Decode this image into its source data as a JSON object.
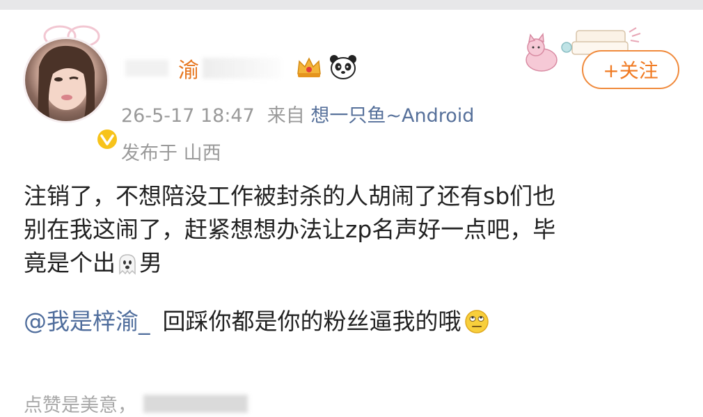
{
  "post": {
    "user": {
      "name_visible": "渝",
      "verified": true,
      "badges": [
        "crown-icon",
        "panda-icon"
      ]
    },
    "meta": {
      "date": "26-5-17 18:47",
      "from_label": "来自",
      "source": "想一只鱼~Android",
      "location_label": "发布于",
      "location": "山西"
    },
    "follow_label": "+关注",
    "content_lines": [
      "注销了，不想陪没工作被封杀的人胡闹了还有sb们也",
      "别在我这闹了，赶紧想想办法让zp名声好一点吧，毕",
      "竟是个出"
    ],
    "content_suffix": "男",
    "mention": "@我是梓渝_",
    "reply_text": "回踩你都是你的粉丝逼我的哦",
    "footer_text": "点赞是美意，"
  },
  "colors": {
    "username": "#e6761f",
    "link": "#4f6d9c",
    "meta": "#9a9a9a",
    "follow": "#f07a22",
    "verified": "#f7c31b"
  }
}
